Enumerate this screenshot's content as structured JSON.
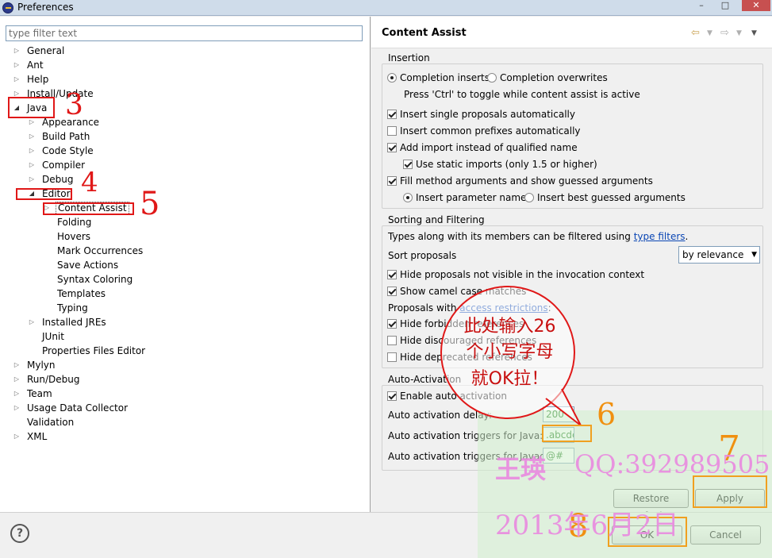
{
  "window": {
    "title": "Preferences",
    "controls": [
      "–",
      "□",
      "✕"
    ]
  },
  "left": {
    "filter_placeholder": "type filter text",
    "tree": [
      {
        "label": "General",
        "level": 0,
        "twisty": "closed"
      },
      {
        "label": "Ant",
        "level": 0,
        "twisty": "closed"
      },
      {
        "label": "Help",
        "level": 0,
        "twisty": "closed"
      },
      {
        "label": "Install/Update",
        "level": 0,
        "twisty": "closed"
      },
      {
        "label": "Java",
        "level": 0,
        "twisty": "open"
      },
      {
        "label": "Appearance",
        "level": 1,
        "twisty": "closed"
      },
      {
        "label": "Build Path",
        "level": 1,
        "twisty": "closed"
      },
      {
        "label": "Code Style",
        "level": 1,
        "twisty": "closed"
      },
      {
        "label": "Compiler",
        "level": 1,
        "twisty": "closed"
      },
      {
        "label": "Debug",
        "level": 1,
        "twisty": "closed"
      },
      {
        "label": "Editor",
        "level": 1,
        "twisty": "open"
      },
      {
        "label": "Content Assist",
        "level": 2,
        "twisty": "closed",
        "selected": true
      },
      {
        "label": "Folding",
        "level": 2,
        "twisty": "none"
      },
      {
        "label": "Hovers",
        "level": 2,
        "twisty": "none"
      },
      {
        "label": "Mark Occurrences",
        "level": 2,
        "twisty": "none"
      },
      {
        "label": "Save Actions",
        "level": 2,
        "twisty": "none"
      },
      {
        "label": "Syntax Coloring",
        "level": 2,
        "twisty": "none"
      },
      {
        "label": "Templates",
        "level": 2,
        "twisty": "none"
      },
      {
        "label": "Typing",
        "level": 2,
        "twisty": "none"
      },
      {
        "label": "Installed JREs",
        "level": 1,
        "twisty": "closed"
      },
      {
        "label": "JUnit",
        "level": 1,
        "twisty": "none"
      },
      {
        "label": "Properties Files Editor",
        "level": 1,
        "twisty": "none"
      },
      {
        "label": "Mylyn",
        "level": 0,
        "twisty": "closed"
      },
      {
        "label": "Run/Debug",
        "level": 0,
        "twisty": "closed"
      },
      {
        "label": "Team",
        "level": 0,
        "twisty": "closed"
      },
      {
        "label": "Usage Data Collector",
        "level": 0,
        "twisty": "closed"
      },
      {
        "label": "Validation",
        "level": 0,
        "twisty": "none"
      },
      {
        "label": "XML",
        "level": 0,
        "twisty": "closed"
      }
    ]
  },
  "right": {
    "title": "Content Assist",
    "insertion": {
      "group_label": "Insertion",
      "completion_inserts": "Completion inserts",
      "completion_overwrites": "Completion overwrites",
      "toggle_hint": "Press 'Ctrl' to toggle while content assist is active",
      "single_proposals": "Insert single proposals automatically",
      "common_prefixes": "Insert common prefixes automatically",
      "add_import": "Add import instead of qualified name",
      "static_imports": "Use static imports (only 1.5 or higher)",
      "fill_method": "Fill method arguments and show guessed arguments",
      "param_names": "Insert parameter names",
      "best_guessed": "Insert best guessed arguments"
    },
    "sorting": {
      "group_label": "Sorting and Filtering",
      "types_text": "Types along with its members can be filtered using ",
      "types_link": "type filters",
      "types_end": ".",
      "sort_label": "Sort proposals",
      "sort_value": "by relevance",
      "hide_not_visible": "Hide proposals not visible in the invocation context",
      "camel_case": "Show camel case matches",
      "access_text": "Proposals with ",
      "access_link": "access restrictions",
      "access_end": ":",
      "hide_forbidden": "Hide forbidden references",
      "hide_discouraged": "Hide discouraged references",
      "hide_deprecated": "Hide deprecated references"
    },
    "auto": {
      "group_label": "Auto-Activation",
      "enable": "Enable auto activation",
      "delay_label": "Auto activation delay:",
      "delay_value": "200",
      "java_label": "Auto activation triggers for Java:",
      "java_value": ".abcde",
      "javadoc_label": "Auto activation triggers for Javadoc:",
      "javadoc_value": "@#"
    },
    "restore_defaults": "Restore Defaults",
    "apply": "Apply"
  },
  "bottom": {
    "help": "?",
    "ok": "OK",
    "cancel": "Cancel"
  },
  "annotations": {
    "n3": "3",
    "n4": "4",
    "n5": "5",
    "n6": "6",
    "n7": "7",
    "n8": "8",
    "bubble_line1": "此处输入26",
    "bubble_line2": "个小写字母",
    "bubble_line3": "就OK拉！",
    "watermark_name": "王瑛",
    "watermark_qq": "QQ:392989505",
    "watermark_date": "2013年6月2日"
  },
  "colors": {
    "annotation_red": "#e01818",
    "annotation_orange": "#f0a020",
    "watermark_pink": "#e98ae0",
    "link_blue": "#0a46b4"
  }
}
